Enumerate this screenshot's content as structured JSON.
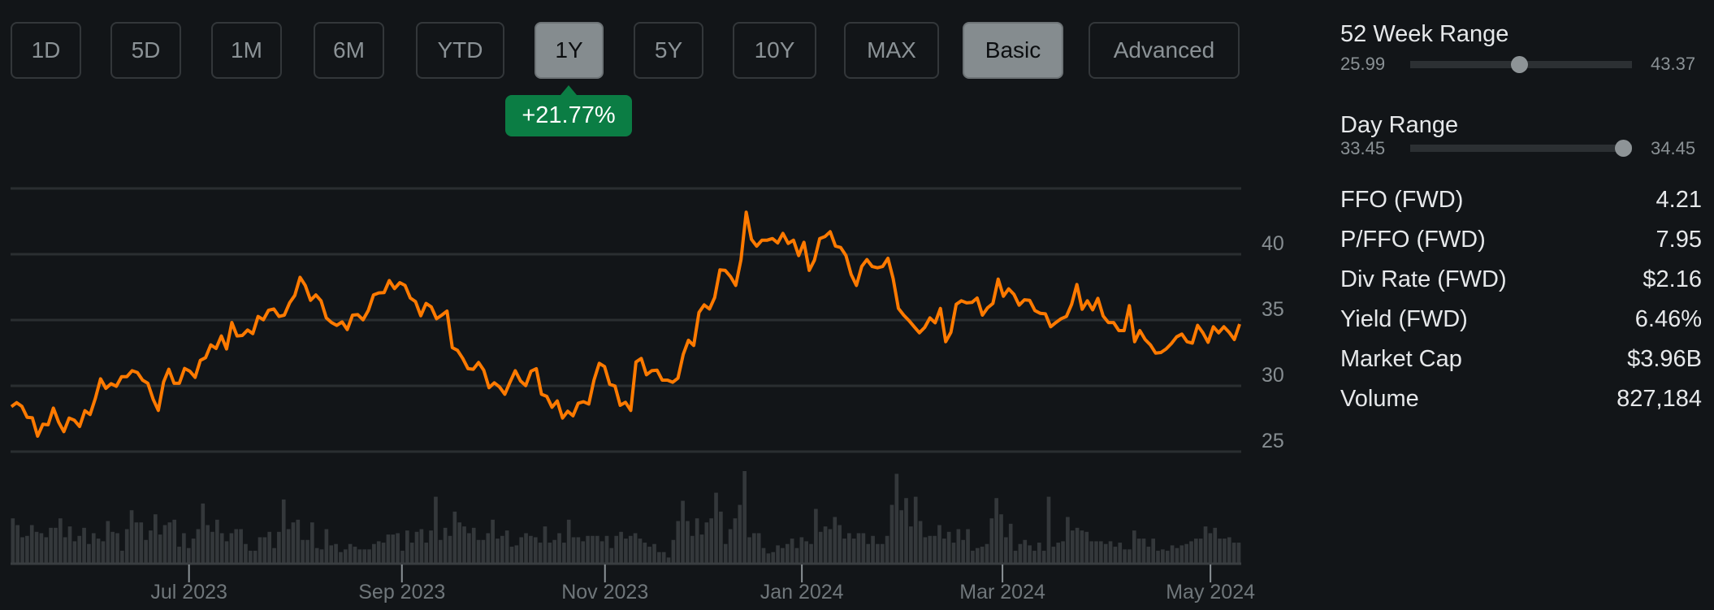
{
  "range_buttons": [
    {
      "label": "1D",
      "active": false
    },
    {
      "label": "5D",
      "active": false
    },
    {
      "label": "1M",
      "active": false
    },
    {
      "label": "6M",
      "active": false
    },
    {
      "label": "YTD",
      "active": false
    },
    {
      "label": "1Y",
      "active": true
    },
    {
      "label": "5Y",
      "active": false
    },
    {
      "label": "10Y",
      "active": false
    },
    {
      "label": "MAX",
      "active": false
    }
  ],
  "mode_buttons": [
    {
      "label": "Basic",
      "active": true
    },
    {
      "label": "Advanced",
      "active": false
    }
  ],
  "change_badge": "+21.77%",
  "colors": {
    "line": "#ff7a00",
    "badge": "#0b7d44",
    "volume": "#34383b",
    "grid": "#2a2e31"
  },
  "stats": {
    "week52": {
      "title": "52 Week Range",
      "low": "25.99",
      "high": "43.37",
      "position": 0.49
    },
    "day": {
      "title": "Day Range",
      "low": "33.45",
      "high": "34.45",
      "position": 0.96
    },
    "rows": [
      {
        "label": "FFO (FWD)",
        "value": "4.21"
      },
      {
        "label": "P/FFO (FWD)",
        "value": "7.95"
      },
      {
        "label": "Div Rate (FWD)",
        "value": "$2.16"
      },
      {
        "label": "Yield (FWD)",
        "value": "6.46%"
      },
      {
        "label": "Market Cap",
        "value": "$3.96B"
      },
      {
        "label": "Volume",
        "value": "827,184"
      }
    ]
  },
  "chart_data": {
    "type": "line",
    "title": "",
    "ylim": [
      25,
      45
    ],
    "yticks": [
      45,
      40,
      35,
      30,
      25
    ],
    "ytick_labels": [
      "",
      "40",
      "35",
      "30",
      "25"
    ],
    "xtick_labels": [
      "Jul 2023",
      "Sep 2023",
      "Nov 2023",
      "Jan 2024",
      "Mar 2024",
      "May 2024"
    ],
    "xtick_positions": [
      0.145,
      0.318,
      0.483,
      0.643,
      0.806,
      0.975
    ],
    "grid": true,
    "series": [
      {
        "name": "Price",
        "values": [
          28.42,
          28.72,
          28.44,
          27.61,
          27.57,
          26.17,
          27.08,
          27.04,
          28.31,
          27.24,
          26.52,
          27.55,
          27.39,
          26.91,
          28.11,
          27.82,
          29.05,
          30.53,
          29.81,
          30.16,
          29.96,
          30.7,
          30.7,
          31.15,
          31.01,
          30.43,
          30.19,
          28.99,
          28.13,
          30.29,
          31.26,
          30.19,
          30.19,
          31.32,
          31.11,
          30.64,
          31.93,
          32.14,
          33.11,
          32.84,
          33.79,
          32.8,
          34.81,
          33.79,
          33.83,
          34.24,
          33.97,
          35.27,
          35.02,
          35.74,
          35.84,
          35.27,
          35.37,
          36.3,
          36.87,
          38.25,
          37.63,
          36.5,
          36.91,
          36.46,
          35.16,
          34.81,
          34.59,
          34.86,
          34.28,
          35.37,
          35.41,
          35.02,
          35.72,
          36.91,
          37.06,
          37.08,
          38.0,
          37.39,
          37.84,
          37.63,
          36.67,
          36.4,
          35.33,
          36.26,
          36.0,
          35.1,
          35.37,
          35.68,
          32.9,
          32.7,
          32.08,
          31.3,
          31.26,
          31.77,
          31.19,
          29.86,
          30.23,
          29.92,
          29.36,
          30.27,
          31.15,
          30.37,
          30.02,
          31.11,
          31.3,
          29.36,
          29.2,
          28.37,
          28.85,
          27.55,
          28.07,
          27.72,
          28.68,
          28.79,
          28.62,
          30.43,
          31.71,
          31.46,
          30.12,
          29.98,
          28.52,
          28.75,
          28.13,
          31.81,
          32.08,
          30.84,
          31.15,
          31.19,
          30.43,
          30.43,
          30.27,
          30.58,
          32.39,
          33.46,
          33.07,
          35.58,
          36.15,
          35.84,
          36.71,
          38.81,
          38.77,
          38.31,
          37.63,
          39.59,
          43.19,
          41.13,
          40.62,
          41.07,
          41.07,
          41.19,
          40.86,
          41.58,
          40.82,
          41.07,
          39.9,
          40.91,
          38.77,
          39.55,
          41.19,
          41.34,
          41.71,
          40.62,
          40.51,
          39.9,
          38.46,
          37.63,
          39.07,
          39.59,
          39.07,
          38.97,
          39.07,
          39.69,
          38.15,
          35.88,
          35.37,
          34.96,
          34.49,
          34.03,
          34.44,
          35.16,
          34.79,
          35.88,
          33.35,
          34.07,
          36.19,
          36.46,
          36.3,
          36.34,
          36.67,
          35.37,
          35.93,
          36.26,
          38.11,
          36.81,
          37.37,
          36.95,
          36.13,
          36.54,
          36.5,
          35.72,
          35.51,
          35.47,
          34.49,
          34.81,
          35.1,
          35.27,
          36.19,
          37.7,
          35.82,
          36.46,
          35.78,
          36.65,
          35.31,
          34.81,
          34.81,
          34.2,
          34.2,
          36.09,
          33.35,
          34.2,
          33.52,
          33.11,
          32.49,
          32.53,
          32.8,
          33.21,
          33.72,
          33.93,
          33.35,
          33.25,
          34.59,
          34.03,
          33.31,
          34.49,
          34.03,
          34.49,
          34.07,
          33.52,
          34.69
        ]
      },
      {
        "name": "Volume (relative)",
        "values": [
          165,
          140,
          95,
          100,
          140,
          115,
          110,
          95,
          130,
          130,
          165,
          95,
          135,
          80,
          100,
          130,
          70,
          110,
          90,
          80,
          155,
          115,
          110,
          45,
          125,
          195,
          150,
          150,
          85,
          120,
          180,
          105,
          140,
          150,
          160,
          60,
          110,
          55,
          90,
          125,
          220,
          140,
          115,
          160,
          110,
          80,
          110,
          125,
          125,
          70,
          45,
          45,
          95,
          95,
          115,
          55,
          115,
          235,
          125,
          150,
          160,
          85,
          85,
          150,
          55,
          50,
          125,
          65,
          70,
          40,
          50,
          70,
          60,
          50,
          50,
          50,
          70,
          80,
          75,
          105,
          105,
          110,
          45,
          120,
          75,
          115,
          125,
          75,
          120,
          245,
          85,
          130,
          100,
          190,
          150,
          135,
          110,
          130,
          85,
          85,
          110,
          160,
          90,
          100,
          120,
          60,
          65,
          95,
          110,
          100,
          95,
          75,
          135,
          75,
          85,
          110,
          75,
          160,
          95,
          95,
          80,
          100,
          100,
          100,
          80,
          100,
          55,
          100,
          115,
          90,
          100,
          110,
          90,
          75,
          60,
          70,
          40,
          40,
          20,
          85,
          155,
          230,
          155,
          100,
          165,
          105,
          150,
          165,
          260,
          190,
          70,
          125,
          165,
          215,
          340,
          95,
          110,
          110,
          55,
          35,
          40,
          65,
          55,
          70,
          90,
          55,
          95,
          80,
          70,
          200,
          115,
          135,
          125,
          170,
          140,
          90,
          110,
          90,
          110,
          110,
          70,
          100,
          70,
          70,
          100,
          215,
          330,
          195,
          240,
          135,
          245,
          155,
          95,
          100,
          100,
          140,
          90,
          115,
          75,
          125,
          85,
          125,
          45,
          55,
          60,
          70,
          165,
          240,
          180,
          95,
          145,
          45,
          70,
          85,
          65,
          45,
          75,
          45,
          245,
          60,
          75,
          80,
          170,
          120,
          130,
          120,
          115,
          80,
          80,
          80,
          70,
          80,
          60,
          75,
          50,
          50,
          120,
          90,
          90,
          60,
          90,
          45,
          50,
          45,
          65,
          55,
          65,
          70,
          80,
          90,
          90,
          135,
          110,
          130,
          90,
          90,
          95,
          75,
          75
        ]
      }
    ]
  }
}
